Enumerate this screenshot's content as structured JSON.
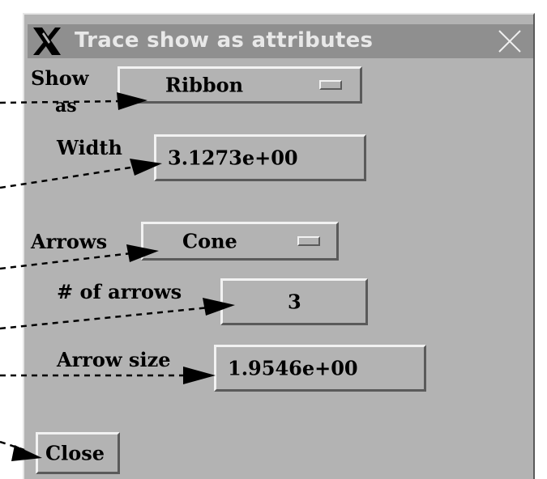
{
  "window": {
    "title": "Trace show as attributes",
    "icon": "x-logo-icon",
    "close_icon": "close-icon"
  },
  "show_as": {
    "label_line1": "Show",
    "label_line2": "as",
    "value": "Ribbon"
  },
  "width": {
    "label": "Width",
    "value": "3.1273e+00"
  },
  "arrows": {
    "label": "Arrows",
    "value": "Cone"
  },
  "num_arrows": {
    "label": "# of arrows",
    "value": "3"
  },
  "arrow_size": {
    "label": "Arrow size",
    "value": "1.9546e+00"
  },
  "close_label": "Close",
  "colors": {
    "window_bg": "#b3b3b3",
    "titlebar_bg": "#8f8f8f",
    "title_text": "#e8e8e8"
  }
}
